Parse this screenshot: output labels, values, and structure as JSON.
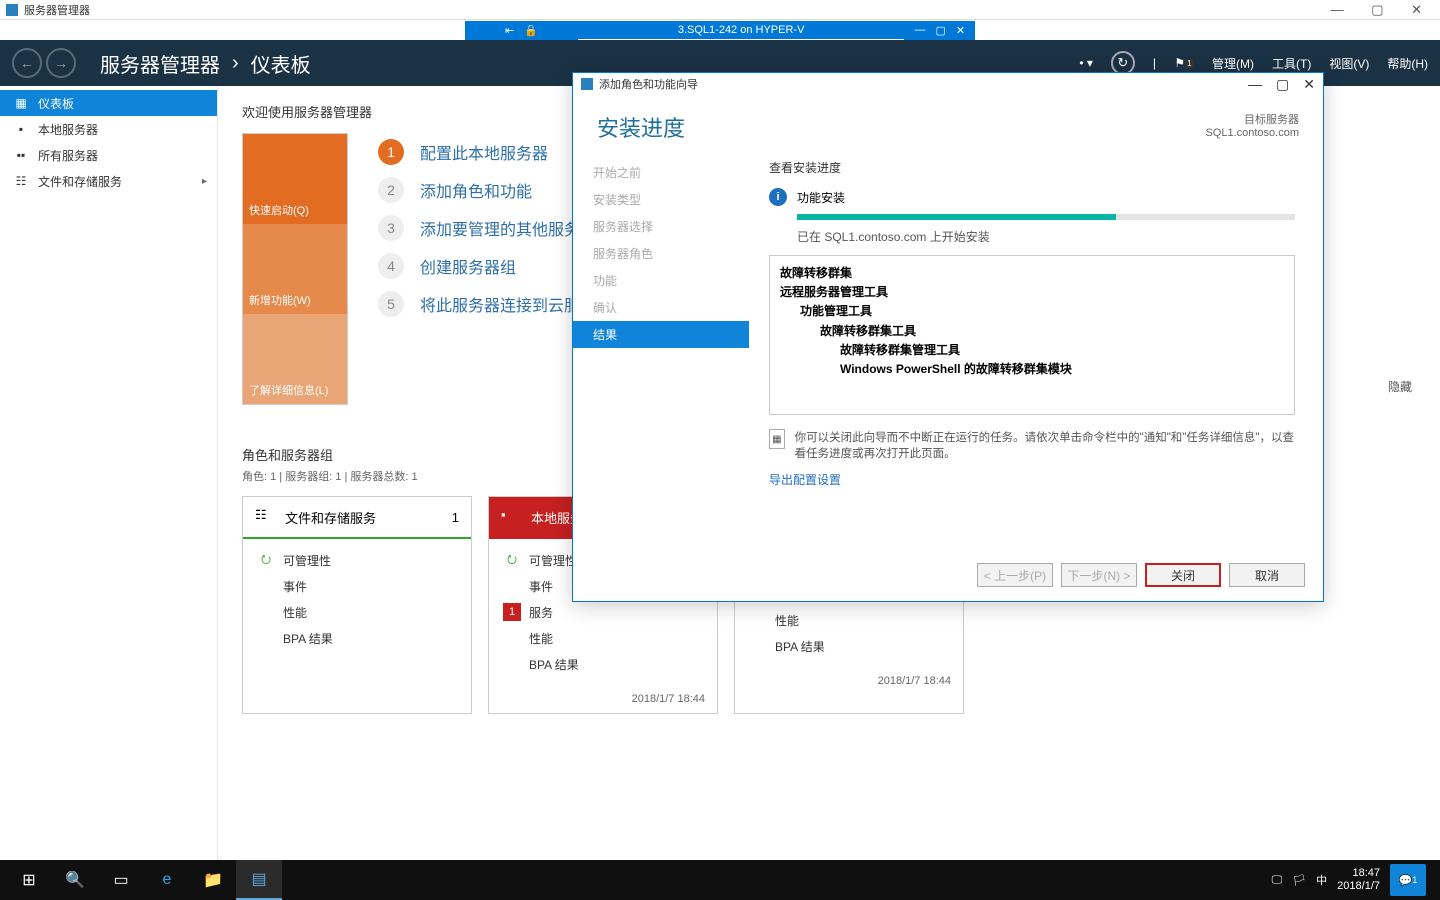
{
  "outer_window": {
    "title": "服务器管理器"
  },
  "hyperv": {
    "vm_title": "3.SQL1-242 on HYPER-V"
  },
  "sm_header": {
    "app": "服务器管理器",
    "crumb": "仪表板",
    "menu": {
      "manage": "管理(M)",
      "tools": "工具(T)",
      "view": "视图(V)",
      "help": "帮助(H)"
    }
  },
  "leftnav": {
    "dashboard": "仪表板",
    "local": "本地服务器",
    "all": "所有服务器",
    "files": "文件和存储服务"
  },
  "welcome": {
    "title": "欢迎使用服务器管理器",
    "tiles": {
      "quick": "快速启动(Q)",
      "new": "新增功能(W)",
      "learn": "了解详细信息(L)"
    },
    "steps": {
      "s1": "配置此本地服务器",
      "s2": "添加角色和功能",
      "s3": "添加要管理的其他服务器",
      "s4": "创建服务器组",
      "s5": "将此服务器连接到云服务"
    }
  },
  "groups": {
    "title": "角色和服务器组",
    "sub": "角色: 1 | 服务器组: 1 | 服务器总数: 1",
    "card_files": {
      "title": "文件和存储服务",
      "count": "1",
      "manage": "可管理性",
      "events": "事件",
      "perf": "性能",
      "bpa": "BPA 结果"
    },
    "card_local": {
      "title": "本地服务器",
      "manage": "可管理性",
      "events": "事件",
      "services": "服务",
      "services_ct": "1",
      "perf": "性能",
      "bpa": "BPA 结果",
      "time": "2018/1/7 18:44"
    },
    "card_all": {
      "perf": "性能",
      "bpa": "BPA 结果",
      "time": "2018/1/7 18:44"
    }
  },
  "hide_label": "隐藏",
  "wizard": {
    "title": "添加角色和功能向导",
    "heading": "安装进度",
    "target_label": "目标服务器",
    "target_server": "SQL1.contoso.com",
    "nav": {
      "before": "开始之前",
      "type": "安装类型",
      "select": "服务器选择",
      "roles": "服务器角色",
      "features": "功能",
      "confirm": "确认",
      "results": "结果"
    },
    "subtitle": "查看安装进度",
    "install_label": "功能安装",
    "started": "已在 SQL1.contoso.com 上开始安装",
    "results": {
      "l1": "故障转移群集",
      "l2": "远程服务器管理工具",
      "l3": "功能管理工具",
      "l4": "故障转移群集工具",
      "l5": "故障转移群集管理工具",
      "l6": "Windows PowerShell 的故障转移群集模块"
    },
    "hint": "你可以关闭此向导而不中断正在运行的任务。请依次单击命令栏中的\"通知\"和\"任务详细信息\"，以查看任务进度或再次打开此页面。",
    "export": "导出配置设置",
    "buttons": {
      "prev": "< 上一步(P)",
      "next": "下一步(N) >",
      "close": "关闭",
      "cancel": "取消"
    }
  },
  "taskbar": {
    "time": "18:47",
    "date": "2018/1/7",
    "ime": "中",
    "notif_ct": "1"
  }
}
